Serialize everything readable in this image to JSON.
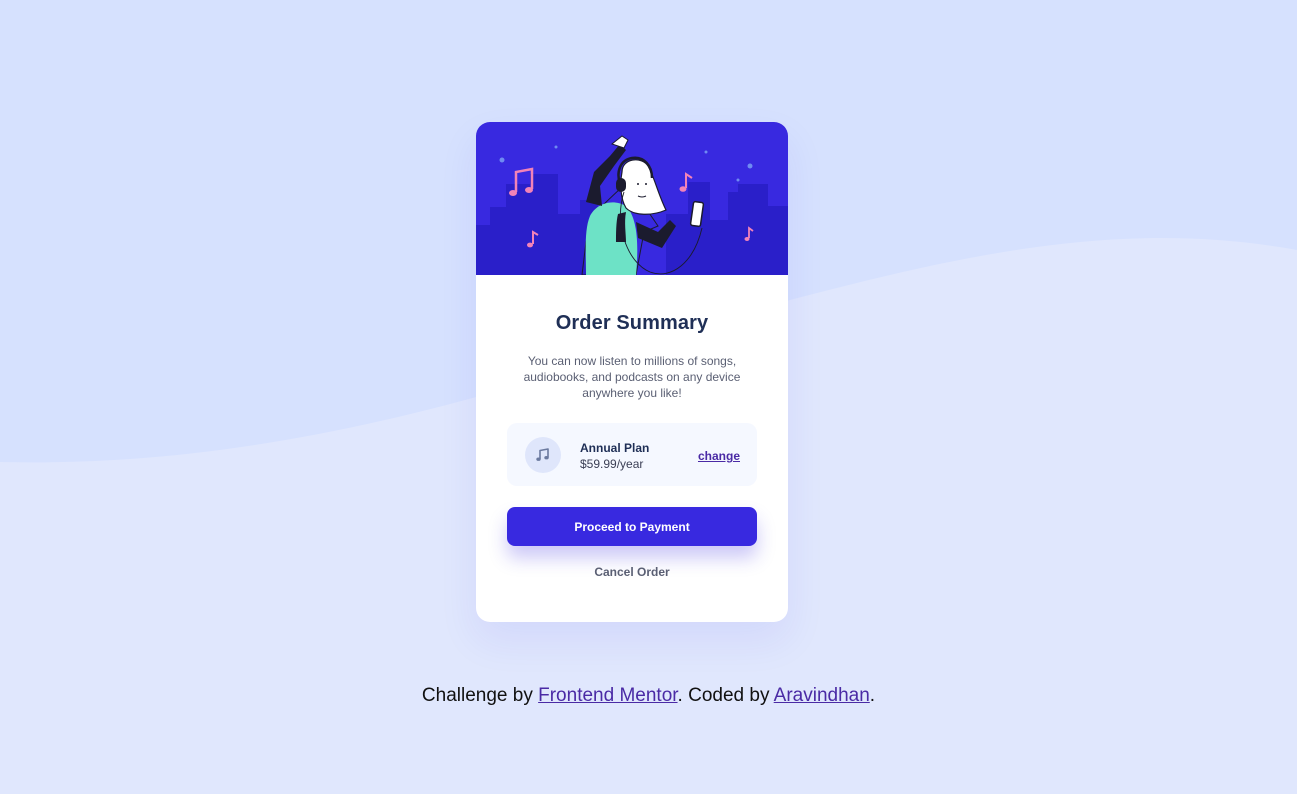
{
  "colors": {
    "page_background": "#e0e7fd",
    "wave": "#d6e1fe",
    "hero_background": "#3829e0",
    "buildings": "#2a1fc9",
    "primary_button": "#3829e0",
    "title": "#1f2f56",
    "link": "#4a2aa5",
    "plan_box": "#f5f8ff"
  },
  "card": {
    "hero_image": "illustration-hero",
    "title": "Order Summary",
    "description": "You can now listen to millions of songs, audiobooks, and podcasts on any device anywhere you like!",
    "plan": {
      "icon": "music-note-icon",
      "name": "Annual Plan",
      "price": "$59.99/year",
      "change_label": "change"
    },
    "proceed_label": "Proceed to Payment",
    "cancel_label": "Cancel Order"
  },
  "footer": {
    "prefix": "Challenge by ",
    "mentor_link": "Frontend Mentor",
    "middle": ". Coded by ",
    "author_link": "Aravindhan",
    "suffix": "."
  }
}
